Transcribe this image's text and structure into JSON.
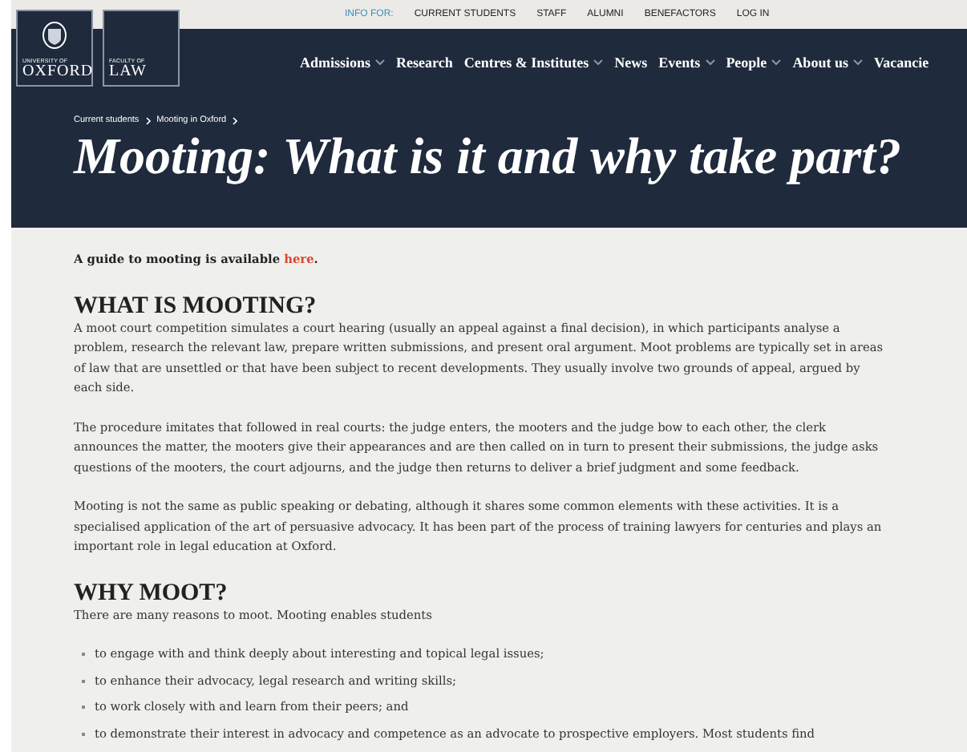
{
  "logos": [
    {
      "small": "UNIVERSITY OF",
      "big": "OXFORD",
      "crest": true
    },
    {
      "small": "FACULTY OF",
      "big": "LAW",
      "crest": false
    }
  ],
  "utility_nav": {
    "label": "INFO FOR:",
    "links": [
      "CURRENT STUDENTS",
      "STAFF",
      "ALUMNI",
      "BENEFACTORS",
      "LOG IN"
    ]
  },
  "main_nav": [
    {
      "label": "Admissions",
      "dropdown": true
    },
    {
      "label": "Research",
      "dropdown": false
    },
    {
      "label": "Centres & Institutes",
      "dropdown": true
    },
    {
      "label": "News",
      "dropdown": false
    },
    {
      "label": "Events",
      "dropdown": true
    },
    {
      "label": "People",
      "dropdown": true
    },
    {
      "label": "About us",
      "dropdown": true
    },
    {
      "label": "Vacancie",
      "dropdown": false
    }
  ],
  "breadcrumb": [
    "Current students",
    "Mooting in Oxford"
  ],
  "title": "Mooting: What is it and why take part?",
  "content": [
    {
      "kind": "intro",
      "text": "A guide to mooting is available ",
      "link": "here",
      "after": "."
    },
    {
      "kind": "heading",
      "text": "WHAT IS MOOTING?"
    },
    {
      "kind": "paragraph",
      "text": "A moot court competition simulates a court hearing (usually an appeal against a final decision), in which participants analyse a problem, research the relevant law, prepare written submissions, and present oral argument. Moot problems are typically set in areas of law that are unsettled or that have been subject to recent developments. They usually involve two grounds of appeal, argued by each side."
    },
    {
      "kind": "paragraph",
      "text": "The procedure imitates that followed in real courts: the judge enters, the mooters and the judge bow to each other, the clerk announces the matter, the mooters give their appearances and are then called on in turn to present their submissions, the judge asks questions of the mooters, the court adjourns, and the judge then returns to deliver a brief judgment and some feedback."
    },
    {
      "kind": "paragraph",
      "text": "Mooting is not the same as public speaking or debating, although it shares some common elements with these activities. It is a specialised application of the art of persuasive advocacy. It has been part of the process of training lawyers for centuries and plays an important role in legal education at Oxford."
    },
    {
      "kind": "heading",
      "text": "WHY MOOT?"
    },
    {
      "kind": "lead",
      "text": "There are many reasons to moot. Mooting enables students"
    },
    {
      "kind": "list",
      "items": [
        "to engage with and think deeply about interesting and topical legal issues;",
        "to enhance their advocacy, legal research and writing skills;",
        "to work closely with and learn from their peers; and",
        "to demonstrate their interest in advocacy and competence as an advocate to prospective employers. Most students find"
      ]
    }
  ]
}
